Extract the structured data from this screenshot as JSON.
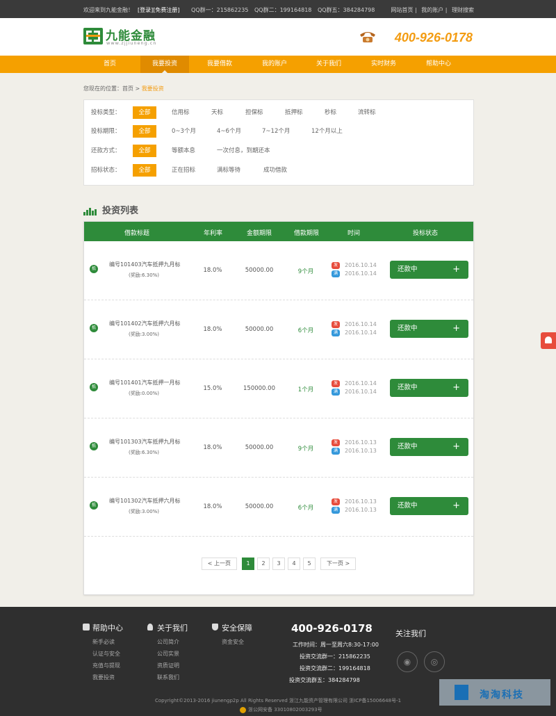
{
  "topbar": {
    "welcome": "欢迎来到九能金融！",
    "login": "[登录]",
    "register": "[免费注册]",
    "qq": [
      "QQ群一：215862235",
      "QQ群二：199164818",
      "QQ群五：384284798"
    ],
    "links": [
      "网站首页 |",
      "我的账户 |",
      "理财搜索"
    ]
  },
  "header": {
    "logo_name": "九能金融",
    "logo_url": "www.zjjiuneng.cn",
    "hotline": "400-926-0178"
  },
  "nav": [
    "首页",
    "我要投资",
    "我要借款",
    "我的账户",
    "关于我们",
    "实时财务",
    "帮助中心"
  ],
  "breadcrumb": {
    "prefix": "您现在的位置：首页 > ",
    "current": "我要投资"
  },
  "filters": [
    {
      "label": "投标类型：",
      "options": [
        "全部",
        "信用标",
        "天标",
        "担保标",
        "抵押标",
        "秒标",
        "流转标"
      ]
    },
    {
      "label": "投标期限：",
      "options": [
        "全部",
        "0~3个月",
        "4~6个月",
        "7~12个月",
        "12个月以上"
      ]
    },
    {
      "label": "还款方式：",
      "options": [
        "全部",
        "等额本息",
        "一次付息，到期还本"
      ]
    },
    {
      "label": "招标状态：",
      "options": [
        "全部",
        "正在招标",
        "满标等待",
        "成功借款"
      ]
    }
  ],
  "list": {
    "title": "投资列表",
    "headers": [
      "借款标题",
      "年利率",
      "金额期限",
      "借款期限",
      "时间",
      "投标状态"
    ],
    "tag": "抵",
    "time_tags": [
      "发",
      "满"
    ],
    "rows": [
      {
        "name": "编号101403汽车抵押九月标",
        "bonus": "(奖励:6.30%)",
        "rate": "18.0%",
        "amount": "50000.00",
        "term": "9个月",
        "d1": "2016.10.14",
        "d2": "2016.10.14",
        "status": "还款中"
      },
      {
        "name": "编号101402汽车抵押六月标",
        "bonus": "(奖励:3.00%)",
        "rate": "18.0%",
        "amount": "50000.00",
        "term": "6个月",
        "d1": "2016.10.14",
        "d2": "2016.10.14",
        "status": "还款中"
      },
      {
        "name": "编号101401汽车抵押一月标",
        "bonus": "(奖励:0.00%)",
        "rate": "15.0%",
        "amount": "150000.00",
        "term": "1个月",
        "d1": "2016.10.14",
        "d2": "2016.10.14",
        "status": "还款中"
      },
      {
        "name": "编号101303汽车抵押九月标",
        "bonus": "(奖励:6.30%)",
        "rate": "18.0%",
        "amount": "50000.00",
        "term": "9个月",
        "d1": "2016.10.13",
        "d2": "2016.10.13",
        "status": "还款中"
      },
      {
        "name": "编号101302汽车抵押六月标",
        "bonus": "(奖励:3.00%)",
        "rate": "18.0%",
        "amount": "50000.00",
        "term": "6个月",
        "d1": "2016.10.13",
        "d2": "2016.10.13",
        "status": "还款中"
      }
    ],
    "plus": "+"
  },
  "pager": {
    "prev": "< 上一页",
    "pages": [
      "1",
      "2",
      "3",
      "4",
      "5"
    ],
    "next": "下一页 >"
  },
  "footer": {
    "help": {
      "title": "帮助中心",
      "items": [
        "新手必读",
        "认证与安全",
        "充值与提现",
        "我要投资"
      ]
    },
    "about": {
      "title": "关于我们",
      "items": [
        "公司简介",
        "公司实景",
        "资质证明",
        "联系我们"
      ]
    },
    "safety": {
      "title": "安全保障",
      "items": [
        "资金安全"
      ]
    },
    "tel": "400-926-0178",
    "info": [
      "工作时间：周一至周六8:30-17:00",
      "投资交流群一：215862235",
      "投资交流群二：199164818",
      "投资交流群五：384284798"
    ],
    "follow": "关注我们",
    "copyright": "Copyright©2013-2016 jiunengp2p All Rights Reserved 浙江九能资产管理有限公司 浙ICP备15006648号-1",
    "police": "浙公网安备 33010802003293号",
    "watermark": "淘淘科技"
  }
}
